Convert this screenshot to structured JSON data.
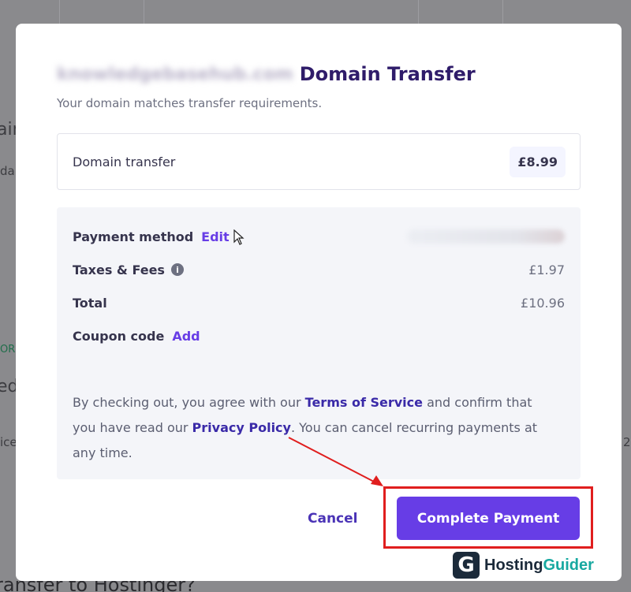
{
  "background": {
    "frag_top": "ain",
    "frag_sub": "da",
    "frag_or": "OR",
    "frag_ed": "ed",
    "frag_ice": "ice",
    "frag_2": "2",
    "frag_bottom": "ransfer to Hostinger?"
  },
  "modal": {
    "domain_blurred": "knowledgebasehub.com",
    "title": "Domain Transfer",
    "subtitle": "Your domain matches transfer requirements.",
    "item": {
      "label": "Domain transfer",
      "price": "£8.99"
    },
    "summary": {
      "payment_method_label": "Payment method",
      "payment_edit_link": "Edit",
      "taxes_label": "Taxes & Fees",
      "taxes_value": "£1.97",
      "total_label": "Total",
      "total_value": "£10.96",
      "coupon_label": "Coupon code",
      "coupon_add_link": "Add"
    },
    "legal": {
      "text1": "By checking out, you agree with our ",
      "terms_link": "Terms of Service",
      "text2": " and confirm that you have read our ",
      "privacy_link": "Privacy Policy",
      "text3": ". You can cancel recurring payments at any time."
    },
    "cancel_label": "Cancel",
    "pay_label": "Complete Payment"
  },
  "watermark": {
    "part1": "Hosting",
    "part2": "Guider",
    "logo_letter": "G"
  },
  "colors": {
    "accent": "#673de6",
    "annotation": "#e01e1e"
  }
}
